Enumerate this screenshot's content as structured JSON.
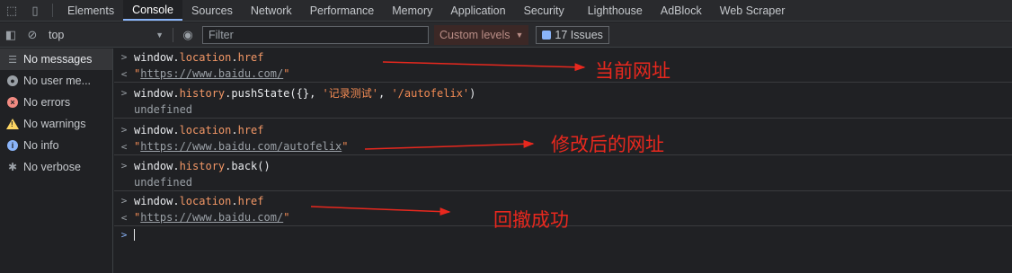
{
  "tabs": [
    {
      "label": "Elements"
    },
    {
      "label": "Console"
    },
    {
      "label": "Sources"
    },
    {
      "label": "Network"
    },
    {
      "label": "Performance"
    },
    {
      "label": "Memory"
    },
    {
      "label": "Application"
    },
    {
      "label": "Security"
    },
    {
      "label": "Lighthouse"
    },
    {
      "label": "AdBlock"
    },
    {
      "label": "Web Scraper"
    }
  ],
  "toolbar": {
    "context": "top",
    "filter_placeholder": "Filter",
    "levels": "Custom levels",
    "issues": "17 Issues"
  },
  "sidebar": {
    "items": [
      {
        "label": "No messages",
        "icon": "list-icon"
      },
      {
        "label": "No user me...",
        "icon": "user-icon"
      },
      {
        "label": "No errors",
        "icon": "error-icon"
      },
      {
        "label": "No warnings",
        "icon": "warning-icon"
      },
      {
        "label": "No info",
        "icon": "info-icon"
      },
      {
        "label": "No verbose",
        "icon": "bug-icon"
      }
    ]
  },
  "console": {
    "r1_obj": "window.",
    "r1_prop1": "location",
    "r1_dot": ".",
    "r1_prop2": "href",
    "r2_url": "https://www.baidu.com/",
    "r3_pre": "window.",
    "r3_prop": "history",
    "r3_mid": ".pushState({}, ",
    "r3_arg1": "'记录测试'",
    "r3_comma": ", ",
    "r3_arg2": "'/autofelix'",
    "r3_close": ")",
    "r4_text": "undefined",
    "r5_obj": "window.",
    "r5_prop1": "location",
    "r5_dot": ".",
    "r5_prop2": "href",
    "r6_url": "https://www.baidu.com/autofelix",
    "r7_pre": "window.",
    "r7_prop": "history",
    "r7_rest": ".back()",
    "r8_text": "undefined",
    "r9_obj": "window.",
    "r9_prop1": "location",
    "r9_dot": ".",
    "r9_prop2": "href",
    "r10_url": "https://www.baidu.com/"
  },
  "annotations": {
    "a1": "当前网址",
    "a2": "修改后的网址",
    "a3": "回撤成功"
  },
  "colors": {
    "annotation": "#e8281e",
    "accent": "#8ab4f8"
  }
}
